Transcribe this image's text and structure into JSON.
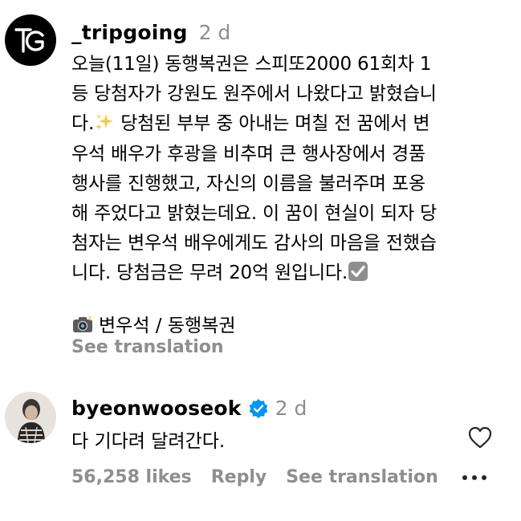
{
  "post": {
    "username": "_tripgoing",
    "time": "2 d",
    "lines": [
      "오늘(11일) 동행복권은 스피또2000 61회차 1",
      "등 당첨자가 강원도 원주에서 나왔다고 밝혔습니",
      "다.",
      "우석 배우가 후광을 비추며 큰 행사장에서 경품",
      "행사를 진행했고, 자신의 이름을 불러주며 포옹",
      "해 주었다고 밝혔는데요. 이 꿈이 현실이 되자 당",
      "첨자는 변우석 배우에게도 감사의 마음을 전했습",
      "니다. 당첨금은 무려 20억 원입니다."
    ],
    "line3_rest": " 당첨된 부부 중 아내는 며칠 전 꿈에서 변",
    "tags": "변우석 / 동행복권",
    "see_translation": "See translation"
  },
  "reply": {
    "username": "byeonwooseok",
    "time": "2 d",
    "text": "다 기다려 달려간다.",
    "likes": "56,258 likes",
    "reply_label": "Reply",
    "see_translation": "See translation"
  },
  "icons": {
    "logo": "tg-logo-icon",
    "sparkles": "sparkles-icon",
    "checkbox": "check-mark-button-icon",
    "camera": "camera-flash-icon",
    "verified": "verified-badge-icon",
    "heart": "heart-icon",
    "more": "more-icon"
  },
  "colors": {
    "verified": "#0095f6",
    "muted": "#8e8e8e"
  }
}
